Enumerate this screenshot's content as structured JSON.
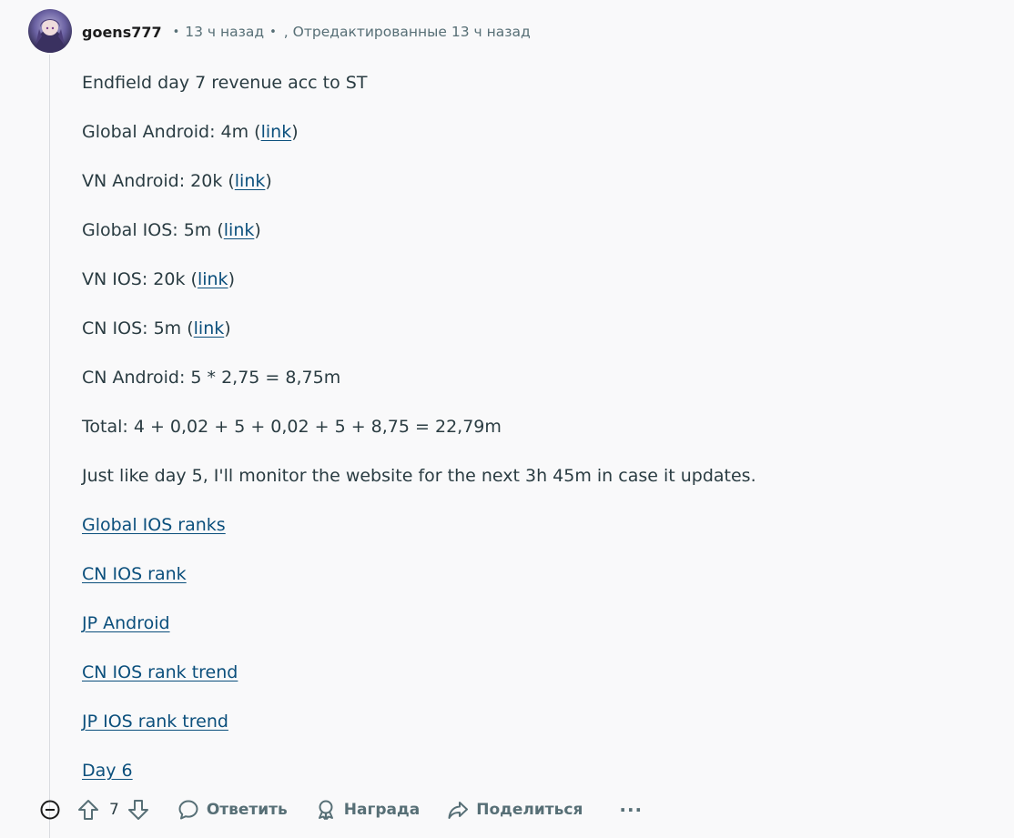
{
  "comment": {
    "author": "goens777",
    "time": "13 ч назад",
    "edited_label": ", Отредактированные 13 ч назад",
    "lines": {
      "l0": "Endfield day 7 revenue acc to ST",
      "l1_pre": "Global Android: 4m (",
      "l1_link": "link",
      "l1_post": ")",
      "l2_pre": "VN Android: 20k (",
      "l2_link": "link",
      "l2_post": ")",
      "l3_pre": "Global IOS: 5m (",
      "l3_link": "link",
      "l3_post": ")",
      "l4_pre": "VN IOS: 20k (",
      "l4_link": "link",
      "l4_post": ")",
      "l5_pre": "CN IOS: 5m (",
      "l5_link": "link",
      "l5_post": ")",
      "l6": "CN Android: 5 * 2,75 = 8,75m",
      "l7": "Total: 4 + 0,02 + 5 + 0,02 + 5 + 8,75 = 22,79m",
      "l8": "Just like day 5, I'll monitor the website for the next 3h 45m in case it updates."
    },
    "links": {
      "global_ios_ranks": "Global IOS ranks",
      "cn_ios_rank": "CN IOS rank",
      "jp_android": "JP Android",
      "cn_ios_rank_trend": "CN IOS rank trend",
      "jp_ios_rank_trend": "JP IOS rank trend",
      "day_6": "Day 6"
    }
  },
  "actions": {
    "vote_count": "7",
    "reply": "Ответить",
    "award": "Награда",
    "share": "Поделиться",
    "more": "···"
  },
  "colors": {
    "link": "#0b4f7c",
    "meta": "#576f76",
    "text": "#2a3c42"
  }
}
